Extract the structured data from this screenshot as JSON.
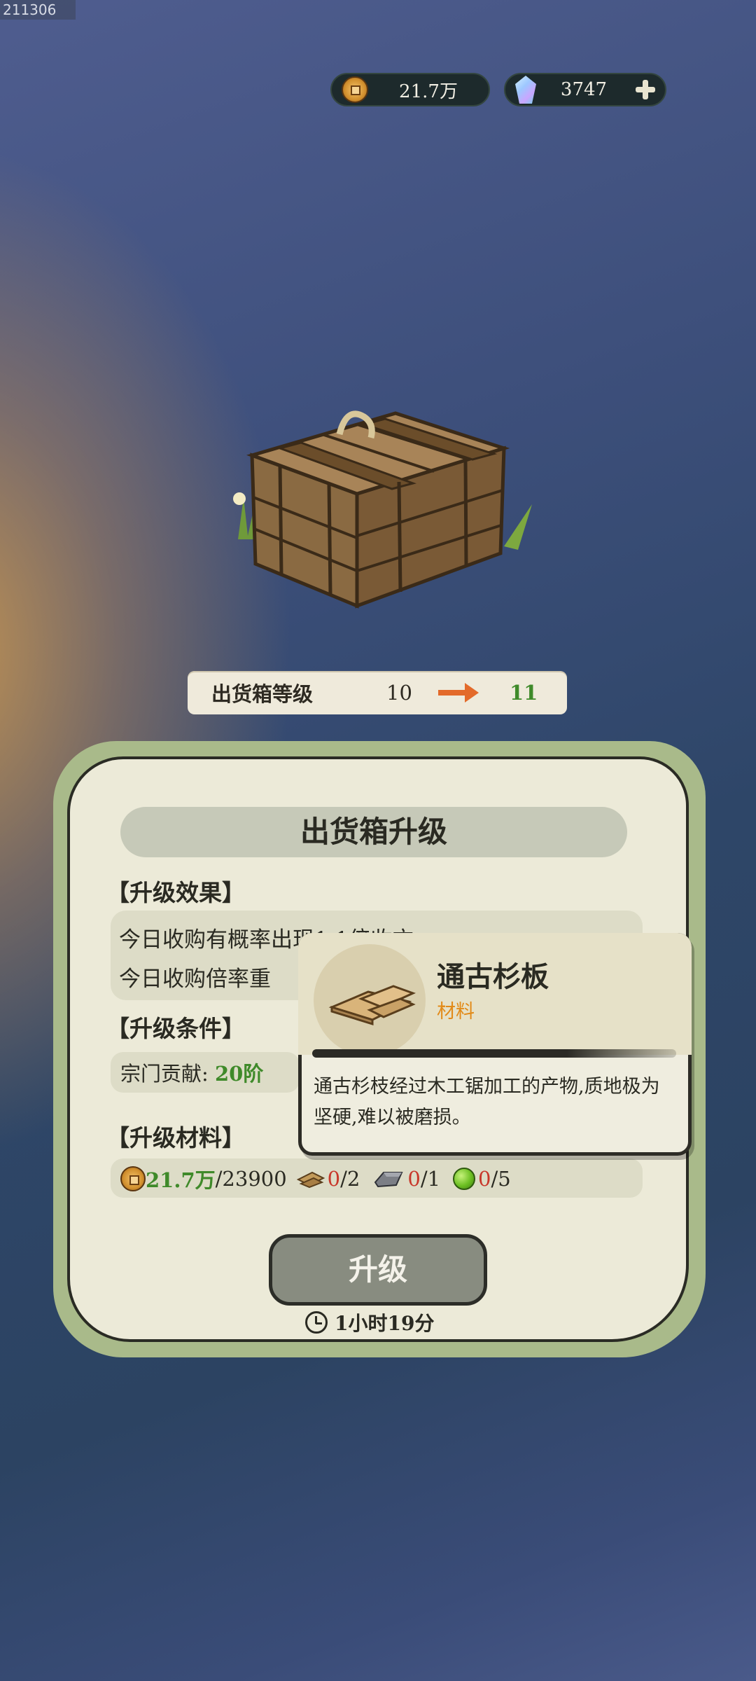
{
  "debug_id": "211306",
  "currency": {
    "coins": "21.7万",
    "gems": "3747"
  },
  "level": {
    "label": "出货箱等级",
    "from": "10",
    "to": "11"
  },
  "panel": {
    "title": "出货箱升级",
    "effects_header": "【升级效果】",
    "effects": [
      "今日收购有概率出现1.1倍收方",
      "今日收购倍率重"
    ],
    "conditions_header": "【升级条件】",
    "condition_label": "宗门贡献: ",
    "condition_value": "20阶",
    "materials_header": "【升级材料】",
    "materials": {
      "coin_have": "21.7万",
      "coin_need": "/23900",
      "plank_have": "0",
      "plank_need": "/2",
      "stone_have": "0",
      "stone_need": "/1",
      "orb_have": "0",
      "orb_need": "/5"
    },
    "upgrade_button": "升级",
    "timer": "1小时19分"
  },
  "tooltip": {
    "name": "通古杉板",
    "type": "材料",
    "description": "通古杉枝经过木工锯加工的产物,质地极为坚硬,难以被磨损。"
  },
  "colors": {
    "green": "#3f8a2a",
    "red": "#c8372a",
    "orange": "#e28a18"
  }
}
